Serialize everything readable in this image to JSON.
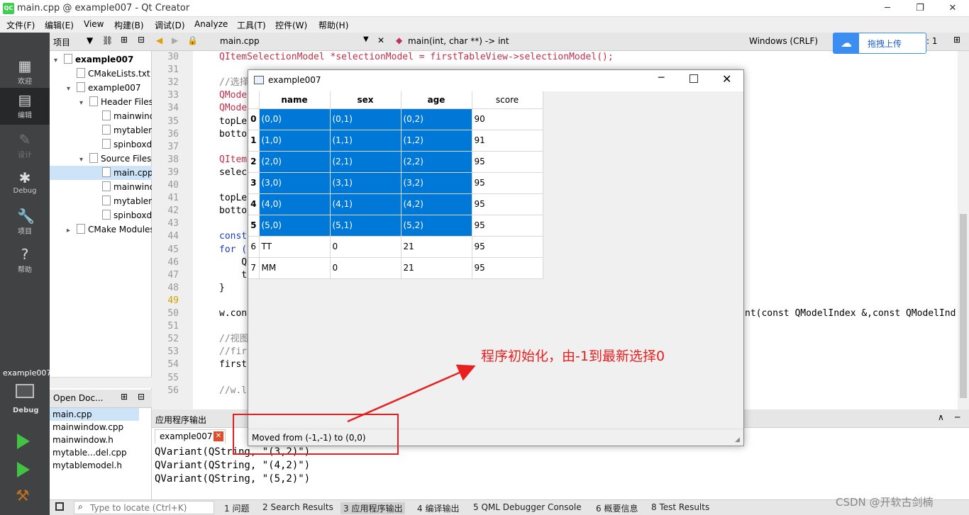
{
  "window": {
    "title": "main.cpp @ example007 - Qt Creator",
    "logo": "QC",
    "min": "─",
    "max": "❐",
    "close": "✕"
  },
  "menubar": [
    "文件(F)",
    "编辑(E)",
    "View",
    "构建(B)",
    "调试(D)",
    "Analyze",
    "工具(T)",
    "控件(W)",
    "帮助(H)"
  ],
  "modes": [
    {
      "label": "欢迎",
      "icon": "grid-icon",
      "glyph": "▦"
    },
    {
      "label": "编辑",
      "icon": "edit-icon",
      "glyph": "▤"
    },
    {
      "label": "设计",
      "icon": "pencil-icon",
      "glyph": "✎"
    },
    {
      "label": "Debug",
      "icon": "bug-icon",
      "glyph": "✱"
    },
    {
      "label": "项目",
      "icon": "wrench-icon",
      "glyph": "🔧"
    },
    {
      "label": "帮助",
      "icon": "help-icon",
      "glyph": "?"
    }
  ],
  "kit": {
    "name": "example007",
    "mode": "Debug"
  },
  "project_panel": {
    "title": "项目",
    "items": [
      {
        "label": "example007",
        "indent": 0,
        "arrow": "▾",
        "bold": true
      },
      {
        "label": "CMakeLists.txt",
        "indent": 1,
        "arrow": ""
      },
      {
        "label": "example007",
        "indent": 1,
        "arrow": "▾"
      },
      {
        "label": "Header Files",
        "indent": 2,
        "arrow": "▾"
      },
      {
        "label": "mainwindow.h",
        "indent": 3,
        "arrow": ""
      },
      {
        "label": "mytablemodel.h",
        "indent": 3,
        "arrow": ""
      },
      {
        "label": "spinboxdelegate.h",
        "indent": 3,
        "arrow": ""
      },
      {
        "label": "Source Files",
        "indent": 2,
        "arrow": "▾"
      },
      {
        "label": "main.cpp",
        "indent": 3,
        "arrow": "",
        "selected": true
      },
      {
        "label": "mainwindow.cpp",
        "indent": 3,
        "arrow": ""
      },
      {
        "label": "mytablemodel.cpp",
        "indent": 3,
        "arrow": ""
      },
      {
        "label": "spinboxdelegate.cpp",
        "indent": 3,
        "arrow": ""
      },
      {
        "label": "CMake Modules",
        "indent": 1,
        "arrow": "▸"
      }
    ]
  },
  "open_docs": {
    "title": "Open Doc...",
    "items": [
      "main.cpp",
      "mainwindow.cpp",
      "mainwindow.h",
      "mytable...del.cpp",
      "mytablemodel.h"
    ]
  },
  "editor": {
    "file": "main.cpp",
    "function": "main(int, char **) -> int",
    "line_ending": "Windows (CRLF)",
    "line_info": ": 1",
    "lines": [
      {
        "n": "30",
        "code": "QItemSelectionModel *selectionModel = firstTableView->selectionModel();"
      },
      {
        "n": "31",
        "code": ""
      },
      {
        "n": "32",
        "code": "//选择"
      },
      {
        "n": "33",
        "code": "QModel"
      },
      {
        "n": "34",
        "code": "QModel"
      },
      {
        "n": "35",
        "code": "topLe"
      },
      {
        "n": "36",
        "code": "botto"
      },
      {
        "n": "37",
        "code": ""
      },
      {
        "n": "38",
        "code": "QItem"
      },
      {
        "n": "39",
        "code": "selec"
      },
      {
        "n": "40",
        "code": ""
      },
      {
        "n": "41",
        "code": "topLe"
      },
      {
        "n": "42",
        "code": "botto"
      },
      {
        "n": "43",
        "code": ""
      },
      {
        "n": "44",
        "code": "const"
      },
      {
        "n": "45",
        "code": "for ("
      },
      {
        "n": "46",
        "code": "    Q"
      },
      {
        "n": "47",
        "code": "    t"
      },
      {
        "n": "48",
        "code": "}"
      },
      {
        "n": "49",
        "code": ""
      },
      {
        "n": "50",
        "code": "w.con"
      },
      {
        "n": "51",
        "code": ""
      },
      {
        "n": "52",
        "code": "//视图"
      },
      {
        "n": "53",
        "code": "//fir"
      },
      {
        "n": "54",
        "code": "first"
      },
      {
        "n": "55",
        "code": ""
      },
      {
        "n": "56",
        "code": "//w.l"
      }
    ],
    "line50_tail": "nt(const QModelIndex &,const QModelInd"
  },
  "output": {
    "title": "应用程序输出",
    "tab": "example007",
    "lines": [
      "QVariant(QString, \"(3,2)\")",
      "QVariant(QString, \"(4,2)\")",
      "QVariant(QString, \"(5,2)\")"
    ]
  },
  "statusbar": {
    "locate_placeholder": "Type to locate (Ctrl+K)",
    "tabs": [
      "1 问题",
      "2 Search Results",
      "3 应用程序输出",
      "4 编译输出",
      "5 QML Debugger Console",
      "6 概要信息",
      "8 Test Results"
    ]
  },
  "dialog": {
    "title": "example007",
    "headers": [
      "name",
      "sex",
      "age",
      "score"
    ],
    "rows": [
      {
        "h": "0",
        "cells": [
          "(0,0)",
          "(0,1)",
          "(0,2)",
          "90"
        ],
        "sel": true
      },
      {
        "h": "1",
        "cells": [
          "(1,0)",
          "(1,1)",
          "(1,2)",
          "91"
        ],
        "sel": true
      },
      {
        "h": "2",
        "cells": [
          "(2,0)",
          "(2,1)",
          "(2,2)",
          "95"
        ],
        "sel": true
      },
      {
        "h": "3",
        "cells": [
          "(3,0)",
          "(3,1)",
          "(3,2)",
          "95"
        ],
        "sel": true
      },
      {
        "h": "4",
        "cells": [
          "(4,0)",
          "(4,1)",
          "(4,2)",
          "95"
        ],
        "sel": true
      },
      {
        "h": "5",
        "cells": [
          "(5,0)",
          "(5,1)",
          "(5,2)",
          "95"
        ],
        "sel": true
      },
      {
        "h": "6",
        "cells": [
          "TT",
          "0",
          "21",
          "95"
        ],
        "sel": false
      },
      {
        "h": "7",
        "cells": [
          "MM",
          "0",
          "21",
          "95"
        ],
        "sel": false
      }
    ],
    "status": "Moved from (-1,-1) to (0,0)"
  },
  "annotation": "程序初始化，由-1到最新选择0",
  "upload_widget": {
    "label": "拖拽上传"
  },
  "watermark": "CSDN @开软古剑楠",
  "colors": {
    "selection": "#0078d7",
    "annotation": "#e82020",
    "modebar": "#404244"
  }
}
